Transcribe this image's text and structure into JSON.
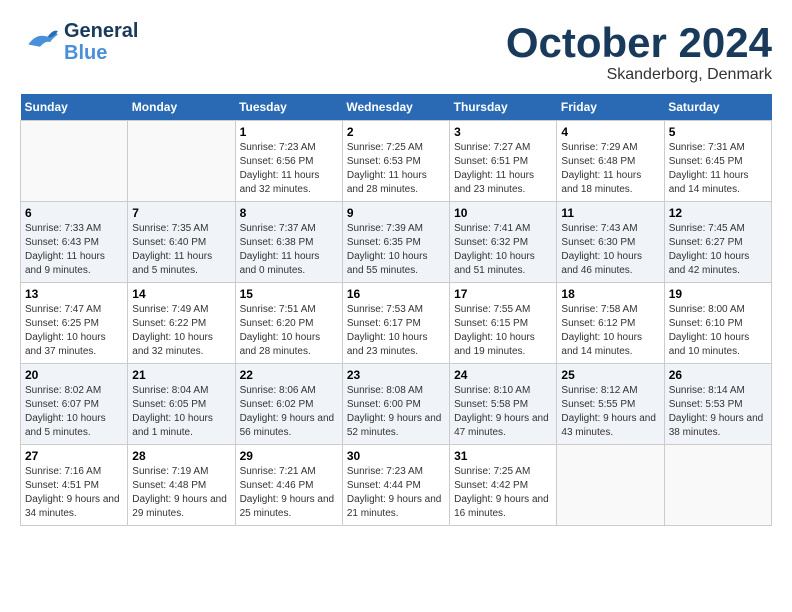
{
  "header": {
    "logo": {
      "line1": "General",
      "line2": "Blue"
    },
    "title": "October 2024",
    "location": "Skanderborg, Denmark"
  },
  "weekdays": [
    "Sunday",
    "Monday",
    "Tuesday",
    "Wednesday",
    "Thursday",
    "Friday",
    "Saturday"
  ],
  "weeks": [
    [
      {
        "day": "",
        "sunrise": "",
        "sunset": "",
        "daylight": ""
      },
      {
        "day": "",
        "sunrise": "",
        "sunset": "",
        "daylight": ""
      },
      {
        "day": "1",
        "sunrise": "Sunrise: 7:23 AM",
        "sunset": "Sunset: 6:56 PM",
        "daylight": "Daylight: 11 hours and 32 minutes."
      },
      {
        "day": "2",
        "sunrise": "Sunrise: 7:25 AM",
        "sunset": "Sunset: 6:53 PM",
        "daylight": "Daylight: 11 hours and 28 minutes."
      },
      {
        "day": "3",
        "sunrise": "Sunrise: 7:27 AM",
        "sunset": "Sunset: 6:51 PM",
        "daylight": "Daylight: 11 hours and 23 minutes."
      },
      {
        "day": "4",
        "sunrise": "Sunrise: 7:29 AM",
        "sunset": "Sunset: 6:48 PM",
        "daylight": "Daylight: 11 hours and 18 minutes."
      },
      {
        "day": "5",
        "sunrise": "Sunrise: 7:31 AM",
        "sunset": "Sunset: 6:45 PM",
        "daylight": "Daylight: 11 hours and 14 minutes."
      }
    ],
    [
      {
        "day": "6",
        "sunrise": "Sunrise: 7:33 AM",
        "sunset": "Sunset: 6:43 PM",
        "daylight": "Daylight: 11 hours and 9 minutes."
      },
      {
        "day": "7",
        "sunrise": "Sunrise: 7:35 AM",
        "sunset": "Sunset: 6:40 PM",
        "daylight": "Daylight: 11 hours and 5 minutes."
      },
      {
        "day": "8",
        "sunrise": "Sunrise: 7:37 AM",
        "sunset": "Sunset: 6:38 PM",
        "daylight": "Daylight: 11 hours and 0 minutes."
      },
      {
        "day": "9",
        "sunrise": "Sunrise: 7:39 AM",
        "sunset": "Sunset: 6:35 PM",
        "daylight": "Daylight: 10 hours and 55 minutes."
      },
      {
        "day": "10",
        "sunrise": "Sunrise: 7:41 AM",
        "sunset": "Sunset: 6:32 PM",
        "daylight": "Daylight: 10 hours and 51 minutes."
      },
      {
        "day": "11",
        "sunrise": "Sunrise: 7:43 AM",
        "sunset": "Sunset: 6:30 PM",
        "daylight": "Daylight: 10 hours and 46 minutes."
      },
      {
        "day": "12",
        "sunrise": "Sunrise: 7:45 AM",
        "sunset": "Sunset: 6:27 PM",
        "daylight": "Daylight: 10 hours and 42 minutes."
      }
    ],
    [
      {
        "day": "13",
        "sunrise": "Sunrise: 7:47 AM",
        "sunset": "Sunset: 6:25 PM",
        "daylight": "Daylight: 10 hours and 37 minutes."
      },
      {
        "day": "14",
        "sunrise": "Sunrise: 7:49 AM",
        "sunset": "Sunset: 6:22 PM",
        "daylight": "Daylight: 10 hours and 32 minutes."
      },
      {
        "day": "15",
        "sunrise": "Sunrise: 7:51 AM",
        "sunset": "Sunset: 6:20 PM",
        "daylight": "Daylight: 10 hours and 28 minutes."
      },
      {
        "day": "16",
        "sunrise": "Sunrise: 7:53 AM",
        "sunset": "Sunset: 6:17 PM",
        "daylight": "Daylight: 10 hours and 23 minutes."
      },
      {
        "day": "17",
        "sunrise": "Sunrise: 7:55 AM",
        "sunset": "Sunset: 6:15 PM",
        "daylight": "Daylight: 10 hours and 19 minutes."
      },
      {
        "day": "18",
        "sunrise": "Sunrise: 7:58 AM",
        "sunset": "Sunset: 6:12 PM",
        "daylight": "Daylight: 10 hours and 14 minutes."
      },
      {
        "day": "19",
        "sunrise": "Sunrise: 8:00 AM",
        "sunset": "Sunset: 6:10 PM",
        "daylight": "Daylight: 10 hours and 10 minutes."
      }
    ],
    [
      {
        "day": "20",
        "sunrise": "Sunrise: 8:02 AM",
        "sunset": "Sunset: 6:07 PM",
        "daylight": "Daylight: 10 hours and 5 minutes."
      },
      {
        "day": "21",
        "sunrise": "Sunrise: 8:04 AM",
        "sunset": "Sunset: 6:05 PM",
        "daylight": "Daylight: 10 hours and 1 minute."
      },
      {
        "day": "22",
        "sunrise": "Sunrise: 8:06 AM",
        "sunset": "Sunset: 6:02 PM",
        "daylight": "Daylight: 9 hours and 56 minutes."
      },
      {
        "day": "23",
        "sunrise": "Sunrise: 8:08 AM",
        "sunset": "Sunset: 6:00 PM",
        "daylight": "Daylight: 9 hours and 52 minutes."
      },
      {
        "day": "24",
        "sunrise": "Sunrise: 8:10 AM",
        "sunset": "Sunset: 5:58 PM",
        "daylight": "Daylight: 9 hours and 47 minutes."
      },
      {
        "day": "25",
        "sunrise": "Sunrise: 8:12 AM",
        "sunset": "Sunset: 5:55 PM",
        "daylight": "Daylight: 9 hours and 43 minutes."
      },
      {
        "day": "26",
        "sunrise": "Sunrise: 8:14 AM",
        "sunset": "Sunset: 5:53 PM",
        "daylight": "Daylight: 9 hours and 38 minutes."
      }
    ],
    [
      {
        "day": "27",
        "sunrise": "Sunrise: 7:16 AM",
        "sunset": "Sunset: 4:51 PM",
        "daylight": "Daylight: 9 hours and 34 minutes."
      },
      {
        "day": "28",
        "sunrise": "Sunrise: 7:19 AM",
        "sunset": "Sunset: 4:48 PM",
        "daylight": "Daylight: 9 hours and 29 minutes."
      },
      {
        "day": "29",
        "sunrise": "Sunrise: 7:21 AM",
        "sunset": "Sunset: 4:46 PM",
        "daylight": "Daylight: 9 hours and 25 minutes."
      },
      {
        "day": "30",
        "sunrise": "Sunrise: 7:23 AM",
        "sunset": "Sunset: 4:44 PM",
        "daylight": "Daylight: 9 hours and 21 minutes."
      },
      {
        "day": "31",
        "sunrise": "Sunrise: 7:25 AM",
        "sunset": "Sunset: 4:42 PM",
        "daylight": "Daylight: 9 hours and 16 minutes."
      },
      {
        "day": "",
        "sunrise": "",
        "sunset": "",
        "daylight": ""
      },
      {
        "day": "",
        "sunrise": "",
        "sunset": "",
        "daylight": ""
      }
    ]
  ]
}
